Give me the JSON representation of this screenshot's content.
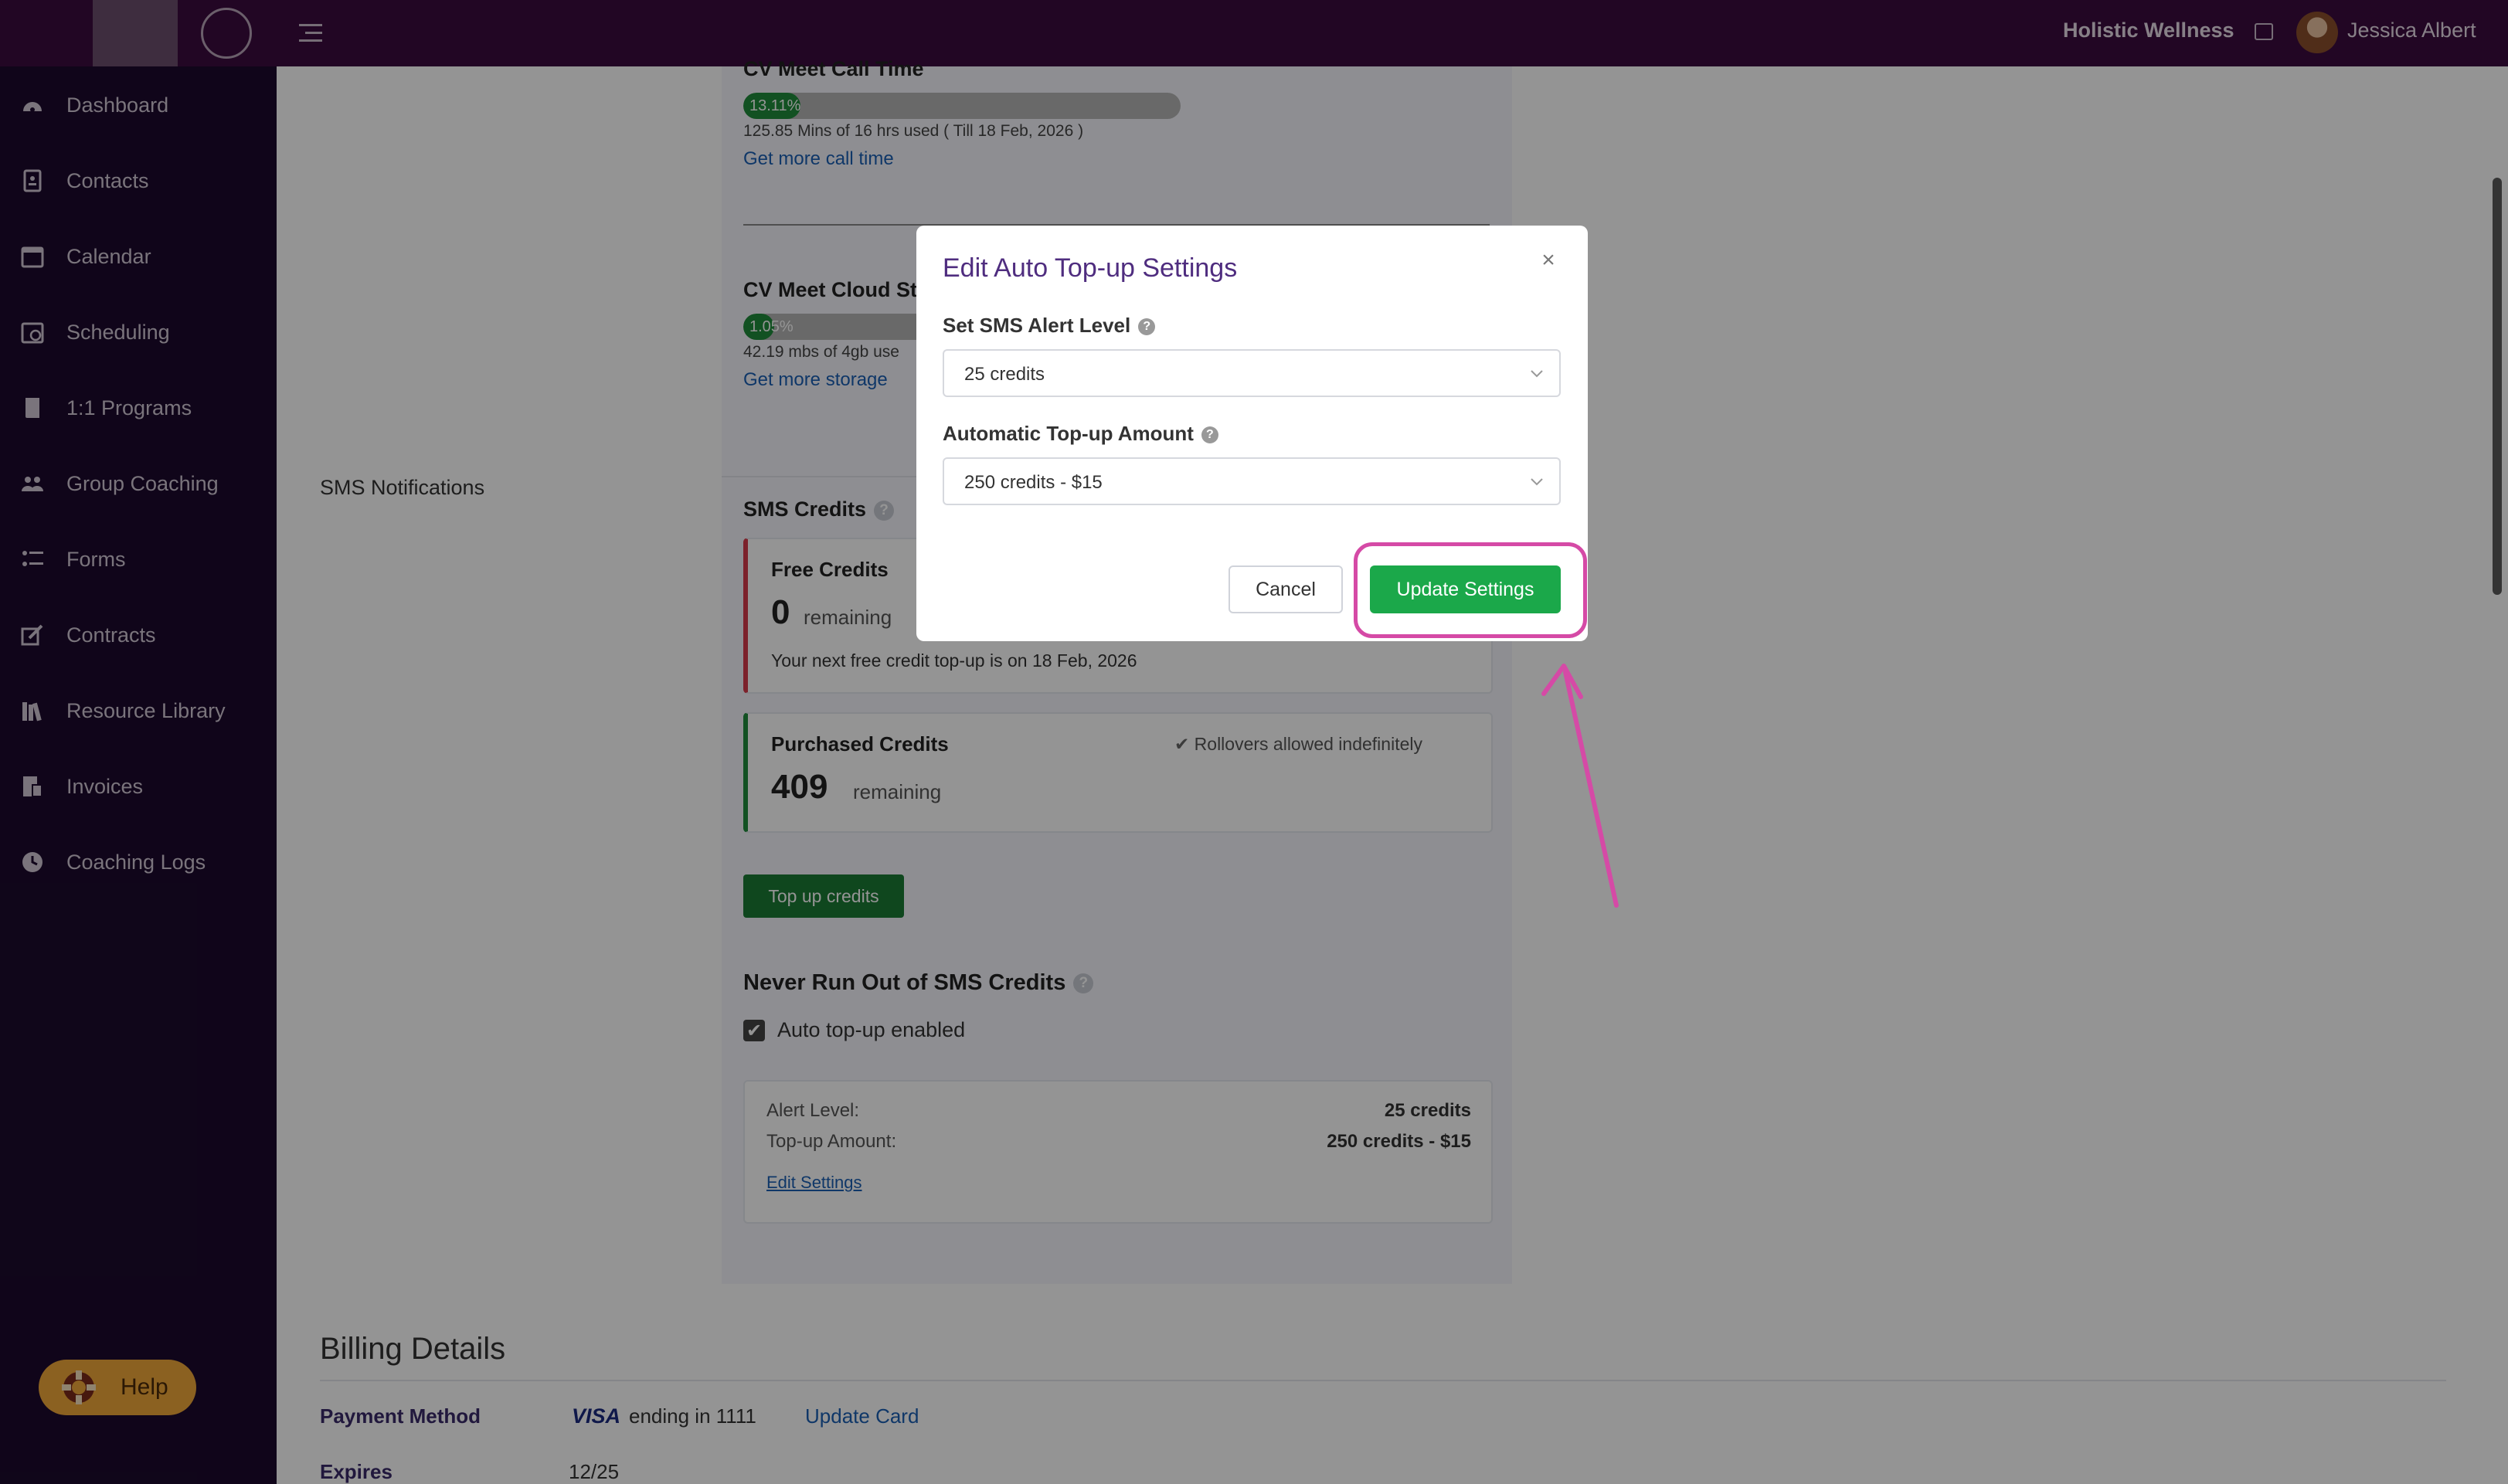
{
  "header": {
    "org_name": "Holistic Wellness",
    "user_name": "Jessica Albert"
  },
  "sidebar": {
    "items": [
      {
        "label": "Dashboard",
        "icon": "dashboard-icon"
      },
      {
        "label": "Contacts",
        "icon": "contacts-icon"
      },
      {
        "label": "Calendar",
        "icon": "calendar-icon"
      },
      {
        "label": "Scheduling",
        "icon": "scheduling-icon"
      },
      {
        "label": "1:1 Programs",
        "icon": "book-icon"
      },
      {
        "label": "Group Coaching",
        "icon": "group-icon"
      },
      {
        "label": "Forms",
        "icon": "forms-icon"
      },
      {
        "label": "Contracts",
        "icon": "contract-icon"
      },
      {
        "label": "Resource Library",
        "icon": "library-icon"
      },
      {
        "label": "Invoices",
        "icon": "invoice-icon"
      },
      {
        "label": "Coaching Logs",
        "icon": "clock-icon"
      }
    ],
    "help_label": "Help"
  },
  "call_time": {
    "title": "CV Meet Call Time",
    "percent": "13.11%",
    "fill_fraction": 0.1311,
    "usage": "125.85 Mins of 16 hrs used ( Till 18 Feb, 2026 )",
    "link": "Get more call time"
  },
  "cloud_storage": {
    "title": "CV Meet Cloud St",
    "percent": "1.05%",
    "fill_fraction": 0.0105,
    "usage": "42.19 mbs of 4gb use",
    "link": "Get more storage"
  },
  "sms": {
    "section_label": "SMS Notifications",
    "credits_title": "SMS Credits",
    "free": {
      "title": "Free Credits",
      "count": "0",
      "remaining": "remaining",
      "next_topup": "Your next free credit top-up is on 18 Feb, 2026"
    },
    "purchased": {
      "title": "Purchased Credits",
      "rollover": "Rollovers allowed indefinitely",
      "count": "409",
      "remaining": "remaining"
    },
    "topup_button": "Top up credits",
    "never_run_out_title": "Never Run Out of SMS Credits",
    "auto_topup_label": "Auto top-up enabled",
    "auto_topup_checked": true,
    "settings": {
      "alert_label": "Alert Level:",
      "alert_value": "25 credits",
      "amount_label": "Top-up Amount:",
      "amount_value": "250 credits - $15",
      "edit_link": "Edit Settings"
    }
  },
  "billing": {
    "title": "Billing Details",
    "payment_method_label": "Payment Method",
    "card_brand": "VISA",
    "card_ending": "ending in 1111",
    "update_card": "Update Card",
    "expires_label": "Expires",
    "expires_value": "12/25"
  },
  "modal": {
    "title": "Edit Auto Top-up Settings",
    "close": "×",
    "alert_level_label": "Set SMS Alert Level",
    "alert_level_value": "25 credits",
    "topup_amount_label": "Automatic Top-up Amount",
    "topup_amount_value": "250 credits - $15",
    "cancel": "Cancel",
    "update": "Update Settings"
  },
  "colors": {
    "topbar": "#3c0b3e",
    "sidebar": "#1c0a2d",
    "accent_green": "#1ba84a",
    "highlight_pink": "#d54aa6"
  }
}
